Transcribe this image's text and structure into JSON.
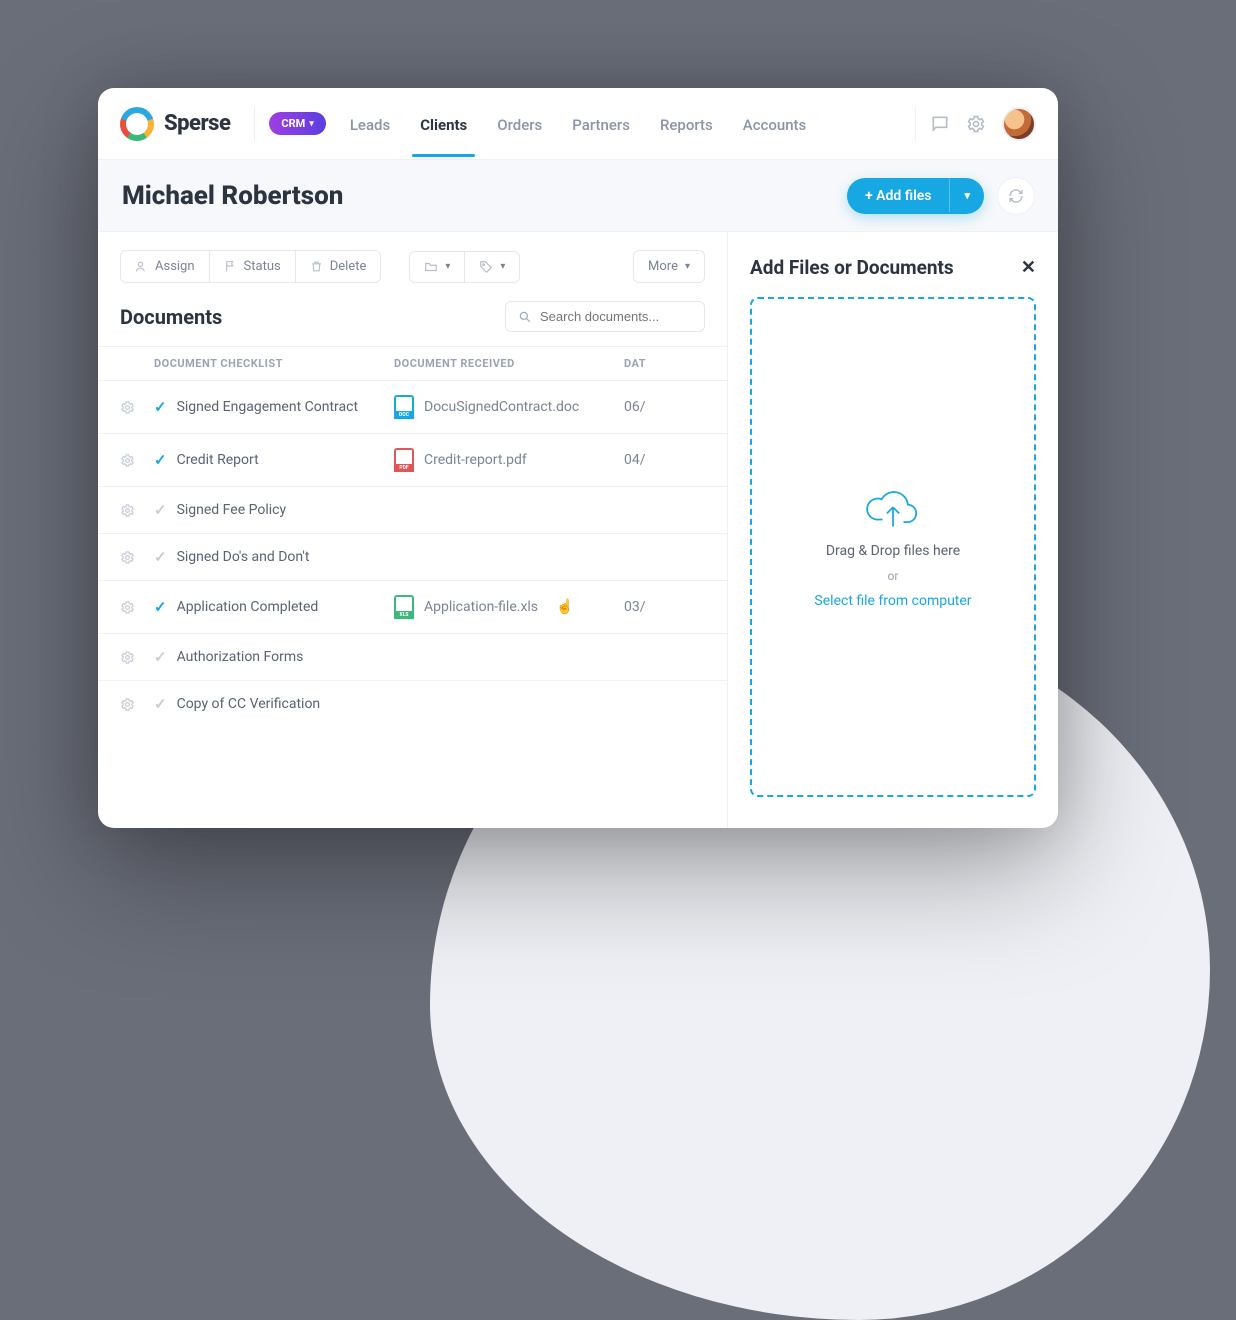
{
  "brand": "Sperse",
  "crm_pill": "CRM",
  "nav": {
    "items": [
      "Leads",
      "Clients",
      "Orders",
      "Partners",
      "Reports",
      "Accounts"
    ],
    "active_index": 1
  },
  "client_name": "Michael Robertson",
  "add_files_label": "+ Add files",
  "actions": {
    "assign": "Assign",
    "status": "Status",
    "delete": "Delete",
    "more": "More"
  },
  "section_title": "Documents",
  "search_placeholder": "Search documents...",
  "columns": {
    "checklist": "DOCUMENT CHECKLIST",
    "received": "DOCUMENT RECEIVED",
    "date": "DAT"
  },
  "rows": [
    {
      "checked": true,
      "name": "Signed Engagement Contract",
      "file": "DocuSignedContract.doc",
      "file_type": "doc",
      "date": "06/"
    },
    {
      "checked": true,
      "name": "Credit Report",
      "file": "Credit-report.pdf",
      "file_type": "pdf",
      "date": "04/"
    },
    {
      "checked": false,
      "name": "Signed Fee Policy",
      "file": "",
      "file_type": "",
      "date": ""
    },
    {
      "checked": false,
      "name": "Signed Do's and Don't",
      "file": "",
      "file_type": "",
      "date": ""
    },
    {
      "checked": true,
      "name": "Application Completed",
      "file": "Application-file.xls",
      "file_type": "xls",
      "date": "03/",
      "cursor": true
    },
    {
      "checked": false,
      "name": "Authorization Forms",
      "file": "",
      "file_type": "",
      "date": ""
    },
    {
      "checked": false,
      "name": "Copy of CC Verification",
      "file": "",
      "file_type": "",
      "date": ""
    }
  ],
  "panel": {
    "title": "Add Files or Documents",
    "drag_text": "Drag & Drop files here",
    "or": "or",
    "select_link": "Select file from computer"
  }
}
